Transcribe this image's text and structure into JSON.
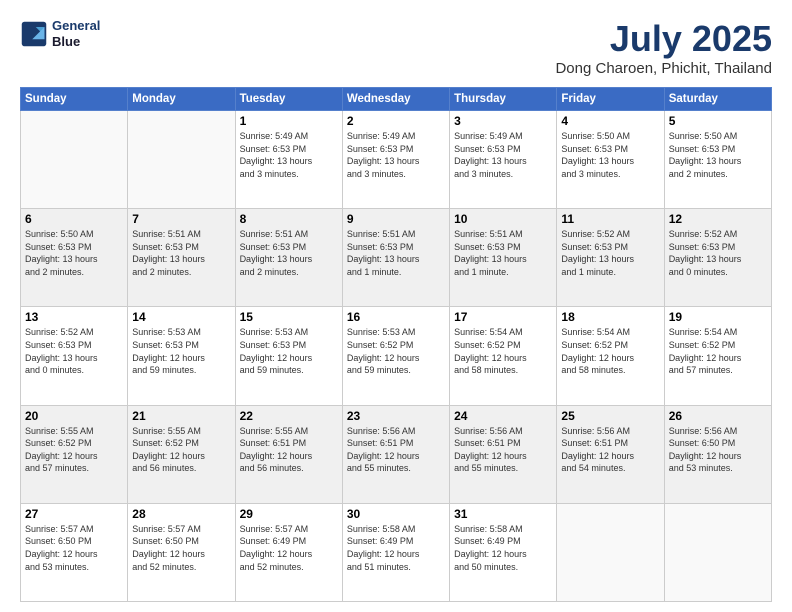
{
  "header": {
    "logo_line1": "General",
    "logo_line2": "Blue",
    "title": "July 2025",
    "subtitle": "Dong Charoen, Phichit, Thailand"
  },
  "days_of_week": [
    "Sunday",
    "Monday",
    "Tuesday",
    "Wednesday",
    "Thursday",
    "Friday",
    "Saturday"
  ],
  "weeks": [
    [
      {
        "num": "",
        "info": ""
      },
      {
        "num": "",
        "info": ""
      },
      {
        "num": "1",
        "info": "Sunrise: 5:49 AM\nSunset: 6:53 PM\nDaylight: 13 hours\nand 3 minutes."
      },
      {
        "num": "2",
        "info": "Sunrise: 5:49 AM\nSunset: 6:53 PM\nDaylight: 13 hours\nand 3 minutes."
      },
      {
        "num": "3",
        "info": "Sunrise: 5:49 AM\nSunset: 6:53 PM\nDaylight: 13 hours\nand 3 minutes."
      },
      {
        "num": "4",
        "info": "Sunrise: 5:50 AM\nSunset: 6:53 PM\nDaylight: 13 hours\nand 3 minutes."
      },
      {
        "num": "5",
        "info": "Sunrise: 5:50 AM\nSunset: 6:53 PM\nDaylight: 13 hours\nand 2 minutes."
      }
    ],
    [
      {
        "num": "6",
        "info": "Sunrise: 5:50 AM\nSunset: 6:53 PM\nDaylight: 13 hours\nand 2 minutes."
      },
      {
        "num": "7",
        "info": "Sunrise: 5:51 AM\nSunset: 6:53 PM\nDaylight: 13 hours\nand 2 minutes."
      },
      {
        "num": "8",
        "info": "Sunrise: 5:51 AM\nSunset: 6:53 PM\nDaylight: 13 hours\nand 2 minutes."
      },
      {
        "num": "9",
        "info": "Sunrise: 5:51 AM\nSunset: 6:53 PM\nDaylight: 13 hours\nand 1 minute."
      },
      {
        "num": "10",
        "info": "Sunrise: 5:51 AM\nSunset: 6:53 PM\nDaylight: 13 hours\nand 1 minute."
      },
      {
        "num": "11",
        "info": "Sunrise: 5:52 AM\nSunset: 6:53 PM\nDaylight: 13 hours\nand 1 minute."
      },
      {
        "num": "12",
        "info": "Sunrise: 5:52 AM\nSunset: 6:53 PM\nDaylight: 13 hours\nand 0 minutes."
      }
    ],
    [
      {
        "num": "13",
        "info": "Sunrise: 5:52 AM\nSunset: 6:53 PM\nDaylight: 13 hours\nand 0 minutes."
      },
      {
        "num": "14",
        "info": "Sunrise: 5:53 AM\nSunset: 6:53 PM\nDaylight: 12 hours\nand 59 minutes."
      },
      {
        "num": "15",
        "info": "Sunrise: 5:53 AM\nSunset: 6:53 PM\nDaylight: 12 hours\nand 59 minutes."
      },
      {
        "num": "16",
        "info": "Sunrise: 5:53 AM\nSunset: 6:52 PM\nDaylight: 12 hours\nand 59 minutes."
      },
      {
        "num": "17",
        "info": "Sunrise: 5:54 AM\nSunset: 6:52 PM\nDaylight: 12 hours\nand 58 minutes."
      },
      {
        "num": "18",
        "info": "Sunrise: 5:54 AM\nSunset: 6:52 PM\nDaylight: 12 hours\nand 58 minutes."
      },
      {
        "num": "19",
        "info": "Sunrise: 5:54 AM\nSunset: 6:52 PM\nDaylight: 12 hours\nand 57 minutes."
      }
    ],
    [
      {
        "num": "20",
        "info": "Sunrise: 5:55 AM\nSunset: 6:52 PM\nDaylight: 12 hours\nand 57 minutes."
      },
      {
        "num": "21",
        "info": "Sunrise: 5:55 AM\nSunset: 6:52 PM\nDaylight: 12 hours\nand 56 minutes."
      },
      {
        "num": "22",
        "info": "Sunrise: 5:55 AM\nSunset: 6:51 PM\nDaylight: 12 hours\nand 56 minutes."
      },
      {
        "num": "23",
        "info": "Sunrise: 5:56 AM\nSunset: 6:51 PM\nDaylight: 12 hours\nand 55 minutes."
      },
      {
        "num": "24",
        "info": "Sunrise: 5:56 AM\nSunset: 6:51 PM\nDaylight: 12 hours\nand 55 minutes."
      },
      {
        "num": "25",
        "info": "Sunrise: 5:56 AM\nSunset: 6:51 PM\nDaylight: 12 hours\nand 54 minutes."
      },
      {
        "num": "26",
        "info": "Sunrise: 5:56 AM\nSunset: 6:50 PM\nDaylight: 12 hours\nand 53 minutes."
      }
    ],
    [
      {
        "num": "27",
        "info": "Sunrise: 5:57 AM\nSunset: 6:50 PM\nDaylight: 12 hours\nand 53 minutes."
      },
      {
        "num": "28",
        "info": "Sunrise: 5:57 AM\nSunset: 6:50 PM\nDaylight: 12 hours\nand 52 minutes."
      },
      {
        "num": "29",
        "info": "Sunrise: 5:57 AM\nSunset: 6:49 PM\nDaylight: 12 hours\nand 52 minutes."
      },
      {
        "num": "30",
        "info": "Sunrise: 5:58 AM\nSunset: 6:49 PM\nDaylight: 12 hours\nand 51 minutes."
      },
      {
        "num": "31",
        "info": "Sunrise: 5:58 AM\nSunset: 6:49 PM\nDaylight: 12 hours\nand 50 minutes."
      },
      {
        "num": "",
        "info": ""
      },
      {
        "num": "",
        "info": ""
      }
    ]
  ]
}
